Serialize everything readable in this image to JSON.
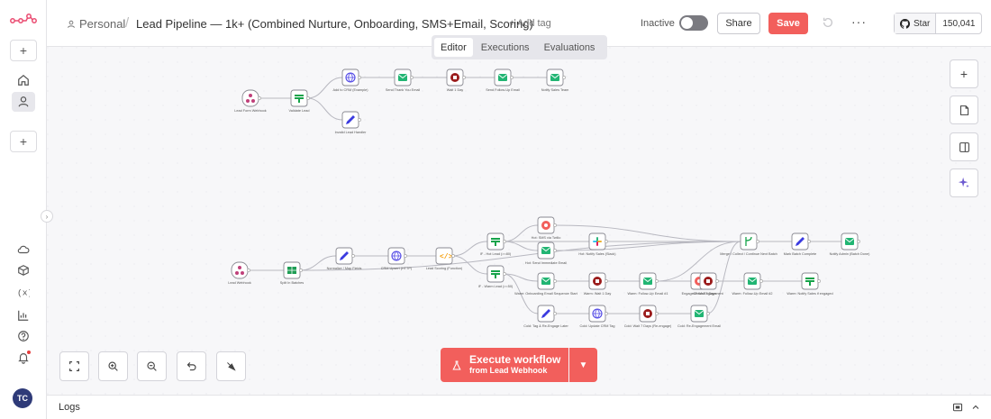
{
  "header": {
    "project": "Personal",
    "separator": "/",
    "workflow_name": "Lead Pipeline — 1k+ (Combined Nurture, Onboarding, SMS+Email, Scoring)",
    "add_tag": "+ Add tag",
    "status_label": "Inactive",
    "share_label": "Share",
    "save_label": "Save",
    "github_star_label": "Star",
    "github_star_count": "150,041"
  },
  "tabs": [
    {
      "label": "Editor",
      "active": true
    },
    {
      "label": "Executions",
      "active": false
    },
    {
      "label": "Evaluations",
      "active": false
    }
  ],
  "execute": {
    "label": "Execute workflow",
    "sublabel": "from Lead Webhook"
  },
  "logs": {
    "label": "Logs"
  },
  "user": {
    "initials": "TC"
  },
  "colors": {
    "accent": "#f25f5c",
    "email_node": "#22b573",
    "http_node": "#4f46e5",
    "edit_node": "#3b3be0",
    "code_node": "#f59e0b",
    "stop_node": "#9b1c1c",
    "switch_node": "#16a34a"
  },
  "workflow": {
    "nodes": [
      {
        "id": "lf-webhook",
        "type": "webhook",
        "label": "Lead Form Webhook"
      },
      {
        "id": "validate",
        "type": "switch",
        "label": "Validate Lead"
      },
      {
        "id": "add-crm",
        "type": "http",
        "label": "Add to CRM (Example)"
      },
      {
        "id": "invalid-handler",
        "type": "edit",
        "label": "Invalid Lead Handler"
      },
      {
        "id": "thankyou",
        "type": "email",
        "label": "Send Thank You Email"
      },
      {
        "id": "wait1",
        "type": "stop",
        "label": "Wait 1 Day"
      },
      {
        "id": "followup",
        "type": "email",
        "label": "Send Follow-Up Email"
      },
      {
        "id": "notify-sales",
        "type": "email",
        "label": "Notify Sales Team"
      },
      {
        "id": "lead-webhook",
        "type": "webhook",
        "label": "Lead Webhook"
      },
      {
        "id": "split-batches",
        "type": "table",
        "label": "Split In Batches"
      },
      {
        "id": "normalize",
        "type": "edit",
        "label": "Normalize / Map Fields"
      },
      {
        "id": "crm-upsert",
        "type": "http",
        "label": "CRM Upsert (HTTP)"
      },
      {
        "id": "scoring",
        "type": "code",
        "label": "Lead Scoring (Function)"
      },
      {
        "id": "hot-lead",
        "type": "switch",
        "label": "IF - Hot Lead (>=80)"
      },
      {
        "id": "warm-lead",
        "type": "switch",
        "label": "IF - Warm Lead (>=50)"
      },
      {
        "id": "twilio",
        "type": "other",
        "label": "Hot: SMS via Twilio"
      },
      {
        "id": "hot-email",
        "type": "email",
        "label": "Hot: Send Immediate Email"
      },
      {
        "id": "slack",
        "type": "slack",
        "label": "Hot: Notify Sales (Slack)"
      },
      {
        "id": "warm-email",
        "type": "email",
        "label": "Warm: Onboarding Email Sequence Start"
      },
      {
        "id": "warm-wait",
        "type": "stop",
        "label": "Warm: Wait 1 Day"
      },
      {
        "id": "warm-followup",
        "type": "email",
        "label": "Warm: Follow-Up Email #1"
      },
      {
        "id": "engaged",
        "type": "other",
        "label": "Engaged? Wait 3 Days"
      },
      {
        "id": "check-engagement",
        "type": "stop",
        "label": "Check Engagement"
      },
      {
        "id": "warm-followup2",
        "type": "email",
        "label": "Warm: Follow-Up Email #2"
      },
      {
        "id": "notify-sales-engaged",
        "type": "switch",
        "label": "Warm: Notify Sales if engaged"
      },
      {
        "id": "cold-tag",
        "type": "edit",
        "label": "Cold: Tag & Re-Engage Later"
      },
      {
        "id": "cold-crm",
        "type": "http",
        "label": "Cold: Update CRM Tag"
      },
      {
        "id": "cold-wait",
        "type": "stop",
        "label": "Cold: Wait 7 Days (Re-engage)"
      },
      {
        "id": "cold-reengage",
        "type": "email",
        "label": "Cold: Re-Engagement Email"
      },
      {
        "id": "merge",
        "type": "merge",
        "label": "Merge / Collect / Continue Next Batch"
      },
      {
        "id": "mark-complete",
        "type": "edit",
        "label": "Mark Batch Complete"
      },
      {
        "id": "notify-admin",
        "type": "email",
        "label": "Notify Admin (Batch Done)"
      }
    ]
  }
}
